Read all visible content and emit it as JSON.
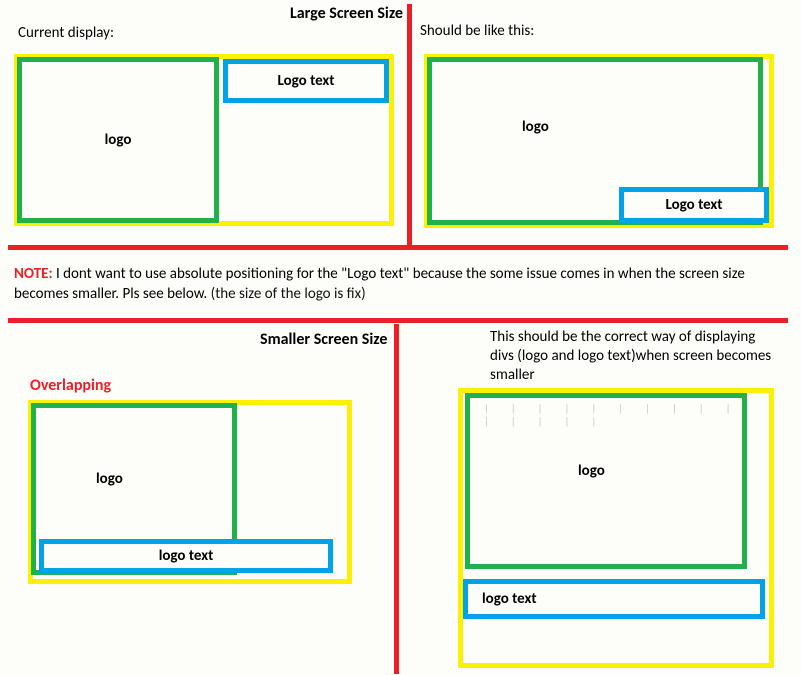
{
  "top": {
    "heading": "Large Screen Size",
    "current_label": "Current display:",
    "should_label": "Should be like this:",
    "left": {
      "logo": "logo",
      "logotext": "Logo text"
    },
    "right": {
      "logo": "logo",
      "logotext": "Logo text"
    }
  },
  "note": {
    "label": "NOTE:",
    "text": " I dont want to use absolute positioning for the \"Logo text\" because the some issue comes in when the screen size becomes smaller. Pls see below.  ",
    "paren": "(the size of the logo is fix)"
  },
  "bottom": {
    "heading": "Smaller Screen Size",
    "desc": "This should be the correct way of displaying divs (logo and logo text)when screen becomes smaller",
    "overlap_label": "Overlapping",
    "left": {
      "logo": "logo",
      "logotext": "logo text"
    },
    "right": {
      "logo": "logo",
      "logotext": "logo text",
      "dots": "| | | | | | | | | | | | | | |"
    }
  }
}
